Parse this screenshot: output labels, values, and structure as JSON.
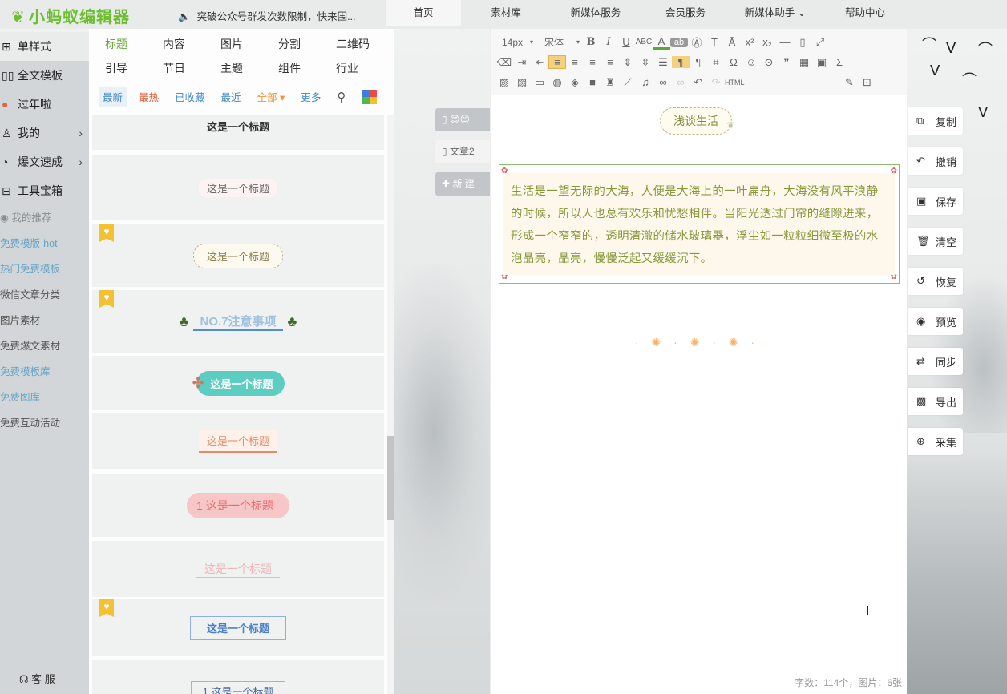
{
  "header": {
    "logo": "小蚂蚁编辑器",
    "notice": "突破公众号群发次数限制，快来围..."
  },
  "topnav": [
    {
      "label": "首页",
      "w": 94,
      "active": true
    },
    {
      "label": "素材库",
      "w": 112
    },
    {
      "label": "新媒体服务",
      "w": 112
    },
    {
      "label": "会员服务",
      "w": 112
    },
    {
      "label": "新媒体助手 ⌄",
      "w": 112
    },
    {
      "label": "帮助中心",
      "w": 112
    }
  ],
  "leftnav": {
    "items": [
      {
        "icon": "single-style-icon",
        "label": "单样式"
      },
      {
        "icon": "full-template-icon",
        "label": "全文模板"
      },
      {
        "icon": "festival-icon",
        "label": "过年啦"
      },
      {
        "icon": "user-icon",
        "label": "我的"
      },
      {
        "icon": "speed-icon",
        "label": "爆文速成"
      },
      {
        "icon": "toolbox-icon",
        "label": "工具宝箱"
      }
    ],
    "recommend_title": "我的推荐",
    "recommend": [
      {
        "label": "免费模版-hot",
        "color": "blue"
      },
      {
        "label": "热门免费模板",
        "color": "blue"
      },
      {
        "label": "微信文章分类",
        "color": "dark"
      },
      {
        "label": "图片素材",
        "color": "dark"
      },
      {
        "label": "免费爆文素材",
        "color": "dark"
      },
      {
        "label": "免费模板库",
        "color": "blue"
      },
      {
        "label": "免费图库",
        "color": "blue"
      },
      {
        "label": "免费互动活动",
        "color": "dark"
      }
    ],
    "service": "客 服"
  },
  "panel": {
    "categories": [
      "标题",
      "内容",
      "图片",
      "分割",
      "二维码",
      "引导",
      "节日",
      "主题",
      "组件",
      "行业"
    ],
    "filters": [
      "最新",
      "最热",
      "已收藏",
      "最近",
      "全部 ▾",
      "更多"
    ],
    "cards": [
      {
        "text": "这是一个标题"
      },
      {
        "text": "这是一个标题"
      },
      {
        "text": "这是一个标题"
      },
      {
        "text": "NO.7注意事项"
      },
      {
        "text": "这是一个标题"
      },
      {
        "text": "这是一个标题"
      },
      {
        "text": "1  这是一个标题"
      },
      {
        "text": "这是一个标题"
      },
      {
        "text": "这是一个标题"
      },
      {
        "text": "1  这是一个标题"
      }
    ]
  },
  "doctabs": [
    {
      "label": "😊😊"
    },
    {
      "label": "文章2"
    },
    {
      "label": "✚ 新 建"
    }
  ],
  "editor": {
    "font_size": "14px",
    "font_family": "宋体",
    "title": "浅谈生活",
    "paragraph": "生活是一望无际的大海，人便是大海上的一叶扁舟，大海没有风平浪静的时候，所以人也总有欢乐和忧愁相伴。当阳光透过门帘的缝隙进来，形成一个窄窄的，透明清澈的储水玻璃器，浮尘如一粒粒细微至极的水泡晶亮，晶亮，慢慢泛起又缓缓沉下。",
    "word_count": "字数：114个，图片：6张"
  },
  "actions": [
    {
      "icon": "copy-icon",
      "label": "复制"
    },
    {
      "icon": "undo-icon",
      "label": "撤销"
    },
    {
      "icon": "save-icon",
      "label": "保存"
    },
    {
      "icon": "trash-icon",
      "label": "清空"
    },
    {
      "icon": "restore-icon",
      "label": "恢复"
    },
    {
      "icon": "eye-icon",
      "label": "预览"
    },
    {
      "icon": "sync-icon",
      "label": "同步"
    },
    {
      "icon": "export-icon",
      "label": "导出"
    },
    {
      "icon": "zoom-icon",
      "label": "采集"
    }
  ],
  "colors": {
    "brand": "#6bbf2c",
    "link_blue": "#3f86c8",
    "paragraph": "#88993c",
    "accent_orange": "#f0923e"
  }
}
